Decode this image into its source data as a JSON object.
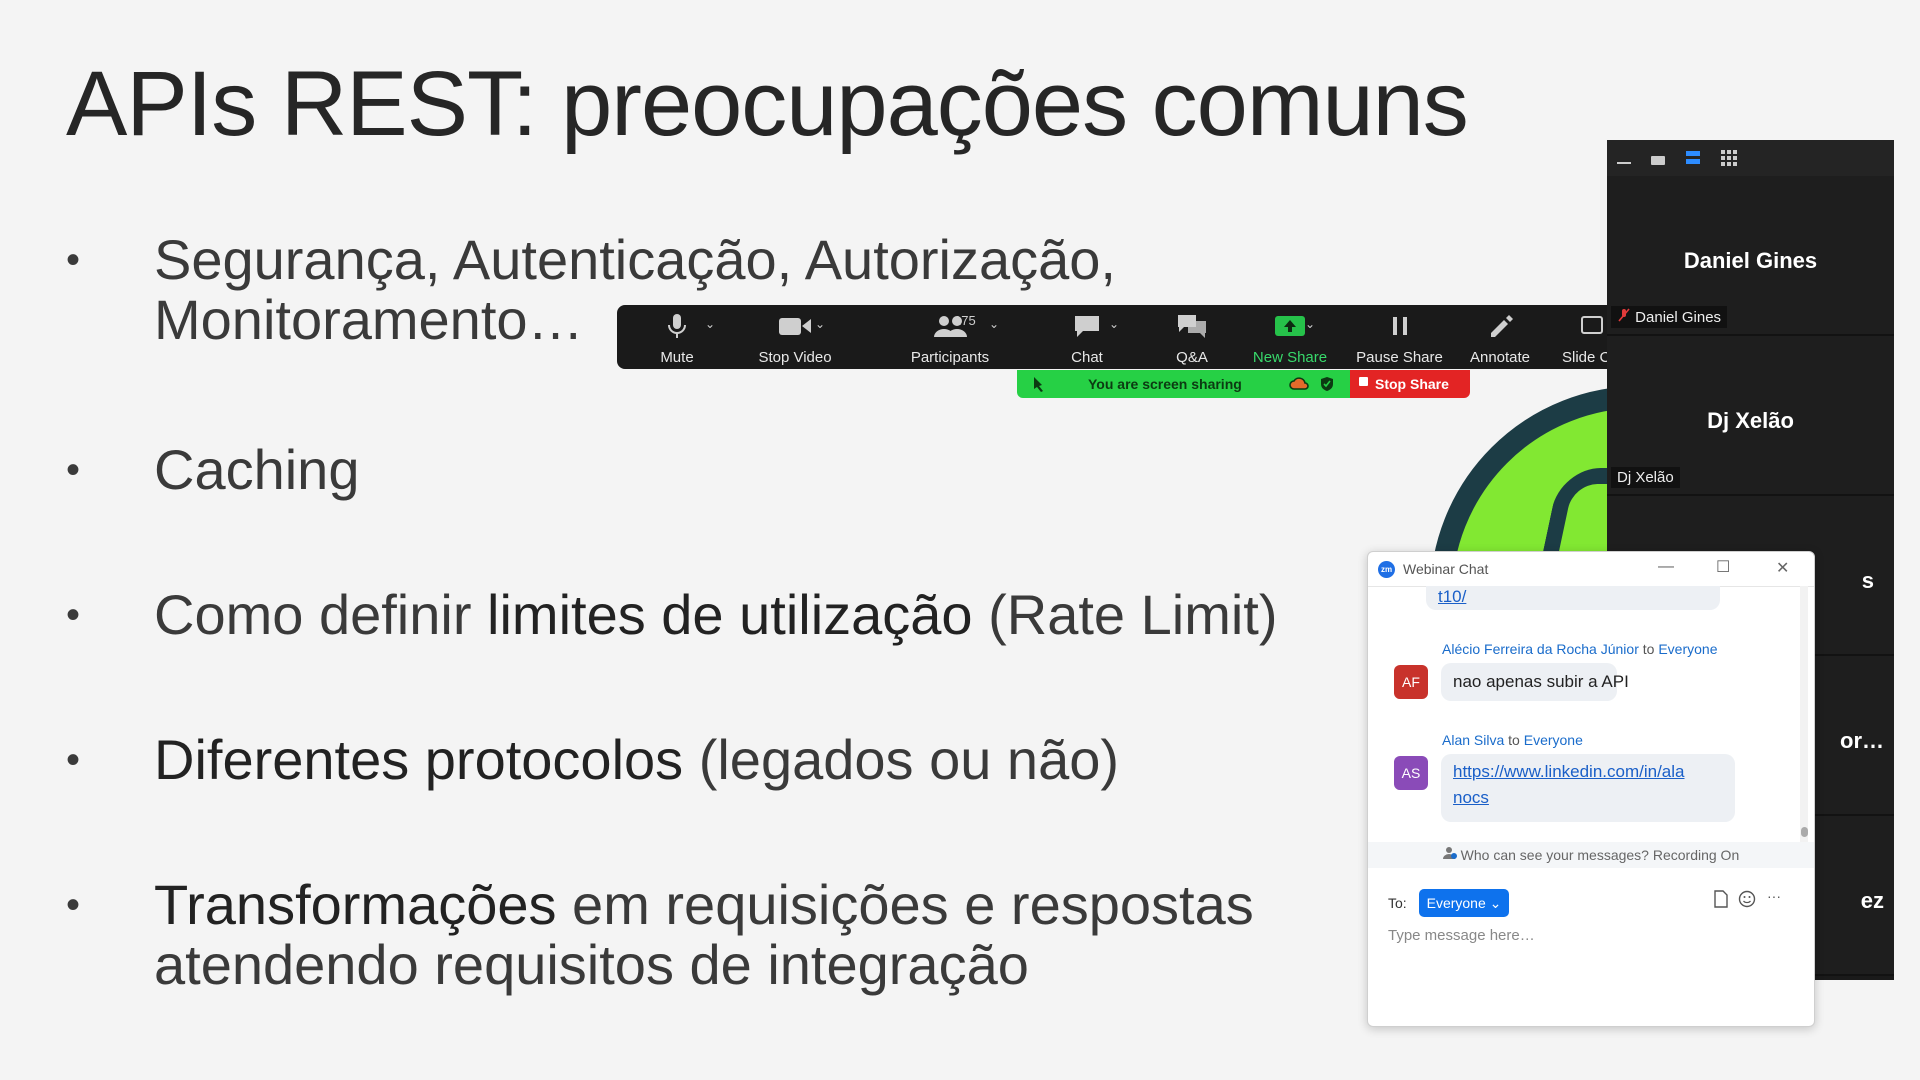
{
  "slide": {
    "title": "APIs REST: preocupações comuns",
    "bullet_symbol": "•",
    "bullets": [
      {
        "line1": "Segurança, Autenticação, Autorização,",
        "line2": "Monitoramento…"
      },
      {
        "line1": "Caching"
      },
      {
        "pre": "Como definir ",
        "bold": "limites de utilização",
        "post": " (Rate Limit)"
      },
      {
        "bold": "Diferentes protocolos",
        "post": " (legados ou não)"
      },
      {
        "bold": "Transformações",
        "post": " em requisições e respostas",
        "line2": "atendendo requisitos de integração"
      }
    ]
  },
  "toolbar": {
    "mute": "Mute",
    "stop_video": "Stop Video",
    "participants": "Participants",
    "participant_count": "175",
    "chat": "Chat",
    "qa": "Q&A",
    "new_share": "New Share",
    "pause_share": "Pause Share",
    "annotate": "Annotate",
    "slide_control": "Slide C"
  },
  "share_bar": {
    "status": "You are screen sharing",
    "stop": "Stop Share"
  },
  "participants_panel": {
    "tiles": [
      {
        "display": "Daniel Gines",
        "tag": "Daniel Gines",
        "muted": true
      },
      {
        "display": "Dj Xelão",
        "tag": "Dj Xelão",
        "muted": false
      },
      {
        "display": "s",
        "tag": ""
      },
      {
        "display": "or…",
        "tag": ""
      },
      {
        "display": "ez",
        "tag": ""
      }
    ]
  },
  "chat": {
    "window_title": "Webinar Chat",
    "app_badge": "zm",
    "partial_link": "t10/",
    "messages": [
      {
        "sender": "Alécio Ferreira da Rocha Júnior",
        "to_word": "to",
        "recipient": "Everyone",
        "initials": "AF",
        "avatar_color": "#c8322b",
        "text": "nao apenas subir a API"
      },
      {
        "sender": "Alan Silva",
        "to_word": "to",
        "recipient": "Everyone",
        "initials": "AS",
        "avatar_color": "#8a4bb8",
        "text_line1": "https://www.linkedin.com/in/ala",
        "text_line2": "nocs"
      }
    ],
    "notice": "Who can see your messages? Recording On",
    "to_label": "To:",
    "recipient_button": "Everyone",
    "input_placeholder": "Type message here…",
    "more": "···"
  }
}
